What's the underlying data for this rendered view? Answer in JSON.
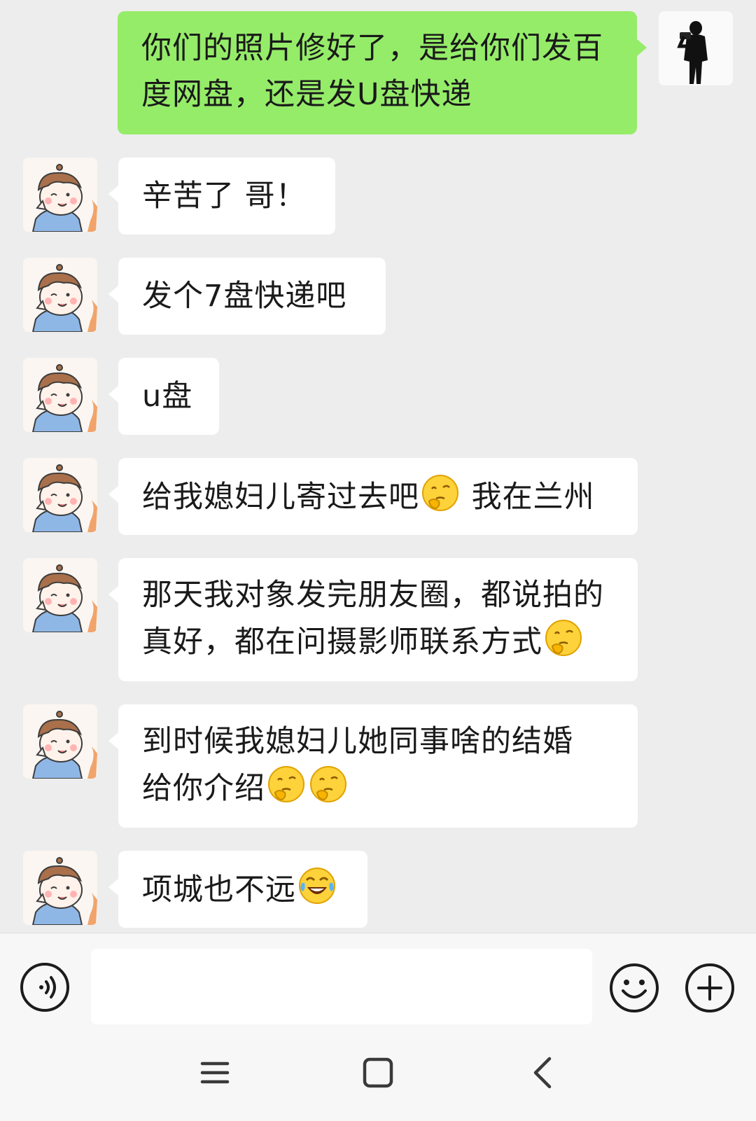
{
  "messages": [
    {
      "side": "out",
      "lines": [
        "你们的照片修好了，是给你们发百",
        "度网盘，还是发U盘快递"
      ]
    },
    {
      "side": "in",
      "text": "辛苦了 哥！"
    },
    {
      "side": "in",
      "text": "发个7盘快递吧"
    },
    {
      "side": "in",
      "text": "u盘"
    },
    {
      "side": "in",
      "parts": [
        "给我媳妇儿寄过去吧",
        "thinking-face-emoji",
        " 我在兰州"
      ]
    },
    {
      "side": "in",
      "lines": [
        "那天我对象发完朋友圈，都说拍的",
        "真好，都在问摄影师联系方式"
      ],
      "trailing_emoji": "thinking-face-emoji"
    },
    {
      "side": "in",
      "lines": [
        "到时候我媳妇儿她同事啥的结婚",
        "给你介绍"
      ],
      "trailing_emojis": [
        "thinking-face-emoji",
        "thinking-face-emoji"
      ]
    },
    {
      "side": "in",
      "text": "项城也不远",
      "trailing_emoji": "tears-of-joy-emoji"
    }
  ],
  "input": {
    "placeholder": ""
  },
  "icons": {
    "voice": "voice-icon",
    "emoji": "smiley-icon",
    "more": "plus-icon",
    "nav_menu": "menu-icon",
    "nav_home": "home-square-icon",
    "nav_back": "back-chevron-icon"
  },
  "colors": {
    "background": "#ededed",
    "outgoing_bubble": "#95ec69",
    "incoming_bubble": "#ffffff"
  }
}
